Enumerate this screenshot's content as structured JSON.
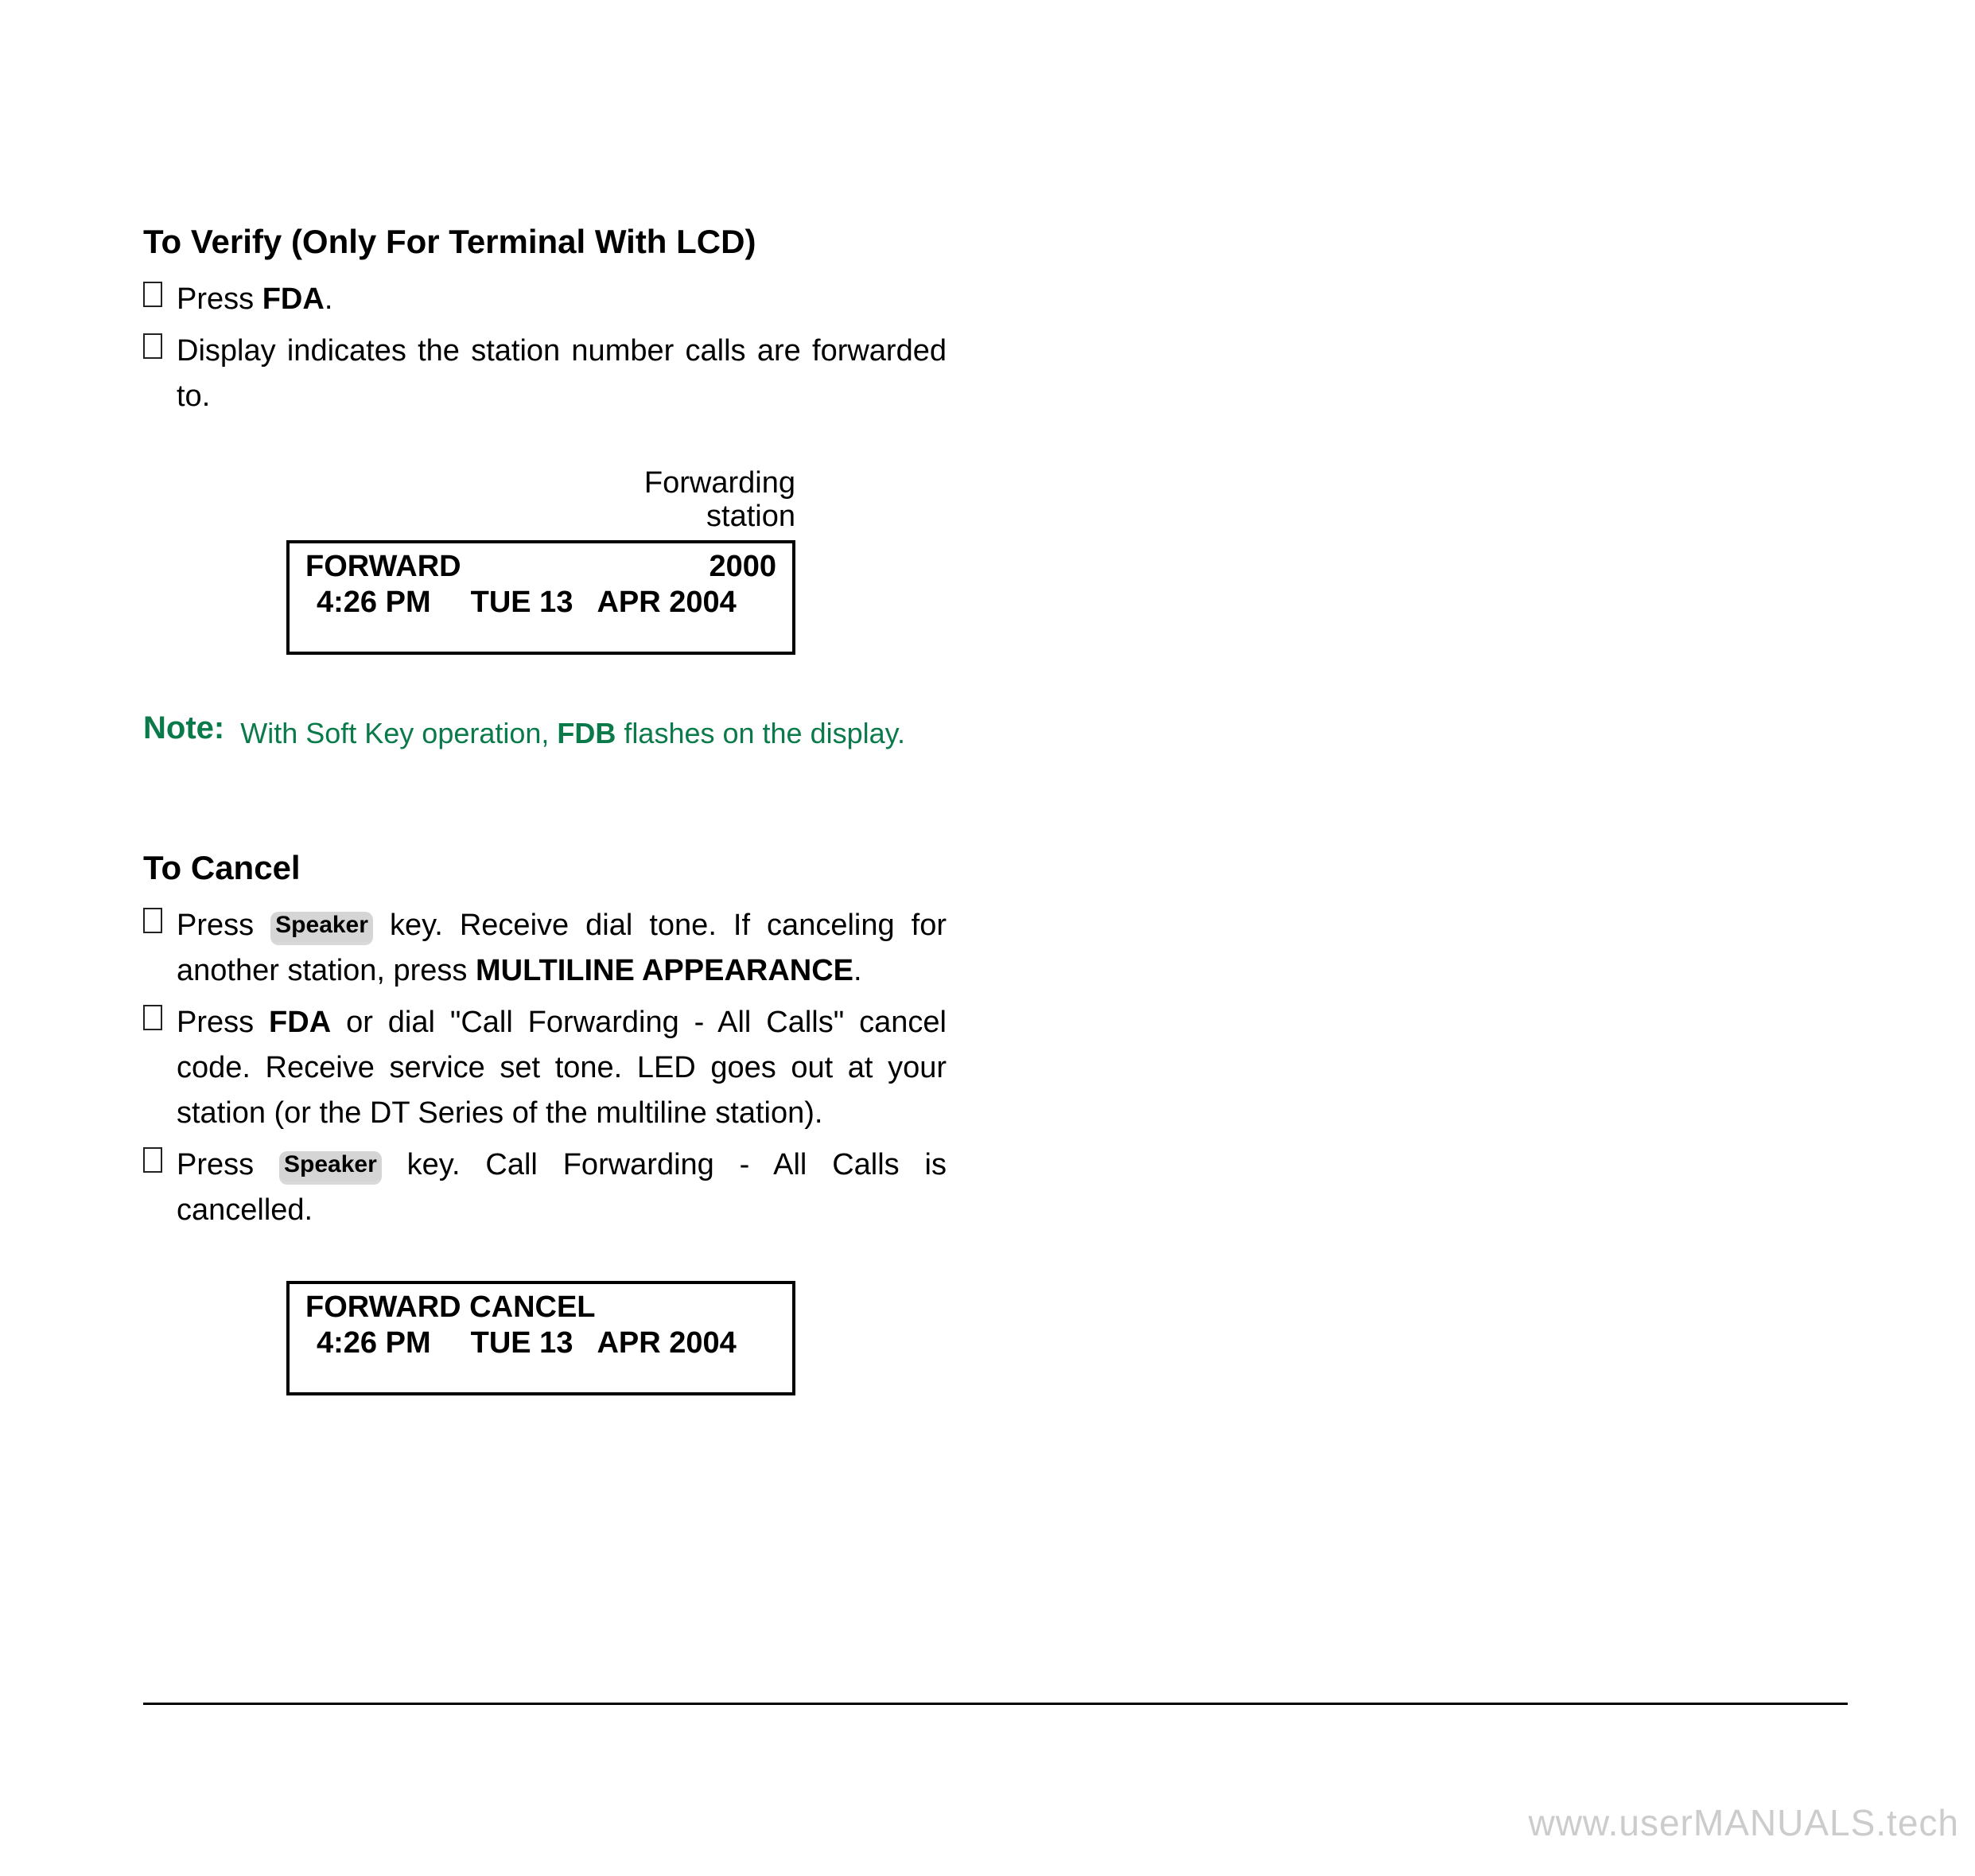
{
  "section1": {
    "title": "To Verify (Only For Terminal With LCD)",
    "items": [
      {
        "prefix": "Press ",
        "bold": "FDA",
        "suffix": "."
      },
      {
        "text": "Display indicates the station number calls are forwarded to."
      }
    ],
    "lcd_label_line1": "Forwarding",
    "lcd_label_line2": "station",
    "lcd": {
      "row1_left": "FORWARD",
      "row1_right": "2000",
      "row2_time": "4:26 PM",
      "row2_day": "TUE 13",
      "row2_date": "APR 2004"
    }
  },
  "note": {
    "label": "Note:",
    "text_pre": "With Soft Key operation, ",
    "text_bold": "FDB",
    "text_post": " flashes on the display."
  },
  "section2": {
    "title": "To Cancel",
    "items": [
      {
        "pre": "Press ",
        "key": "Speaker",
        "mid": " key. Receive dial tone. If canceling for another station, press ",
        "bold": "MULTILINE APPEARANCE",
        "post": "."
      },
      {
        "pre": "Press ",
        "bold": "FDA",
        "post": " or dial \"Call Forwarding - All Calls\" cancel code. Receive service set tone. LED goes out at your station (or the DT Series of the multiline station)."
      },
      {
        "pre": "Press ",
        "key": "Speaker",
        "post": " key. Call Forwarding - All Calls is cancelled."
      }
    ],
    "lcd": {
      "row1_left": "FORWARD CANCEL",
      "row2_time": "4:26 PM",
      "row2_day": "TUE 13",
      "row2_date": "APR 2004"
    }
  },
  "watermark": {
    "part1": "www.user",
    "part2": "MANUALS",
    "part3": ".tech"
  }
}
